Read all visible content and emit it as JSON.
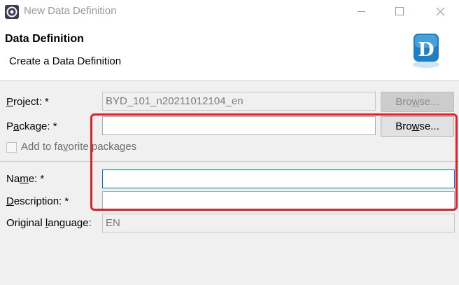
{
  "window": {
    "title": "New Data Definition",
    "icon": "eclipse-app-icon",
    "controls": [
      "minimize-icon",
      "maximize-icon",
      "close-icon"
    ]
  },
  "header": {
    "title": "Data Definition",
    "description": "Create a Data Definition",
    "logo_letter": "D"
  },
  "form": {
    "project": {
      "label_pre": "",
      "label_key": "P",
      "label_post": "roject: *",
      "value": "BYD_101_n20211012104_en",
      "browse": {
        "pre": "Bro",
        "key": "w",
        "post": "se..."
      }
    },
    "package": {
      "label_pre": "P",
      "label_key": "a",
      "label_post": "ckage: *",
      "value": "",
      "browse": {
        "pre": "Bro",
        "key": "w",
        "post": "se..."
      }
    },
    "favorite": {
      "label_pre": "Add to fa",
      "label_key": "v",
      "label_post": "orite packages",
      "checked": false
    },
    "name": {
      "label_pre": "Na",
      "label_key": "m",
      "label_post": "e: *",
      "value": ""
    },
    "description": {
      "label_pre": "",
      "label_key": "D",
      "label_post": "escription: *",
      "value": ""
    },
    "language": {
      "label_pre": "Original ",
      "label_key": "l",
      "label_post": "anguage:",
      "value": "EN"
    }
  },
  "colors": {
    "highlight": "#ea1c24",
    "focus": "#0078d7",
    "logo": "#1f7fc4"
  }
}
